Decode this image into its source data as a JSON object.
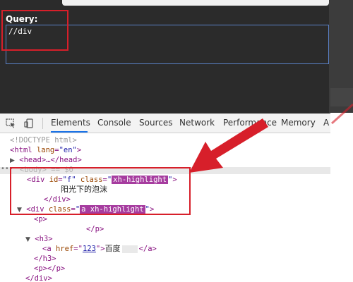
{
  "query_panel": {
    "label": "Query:",
    "value": "//div"
  },
  "toolbar": {
    "icons": [
      "inspect-element-icon",
      "device-toolbar-icon"
    ],
    "tabs": [
      {
        "label": "Elements",
        "active": true
      },
      {
        "label": "Console",
        "active": false
      },
      {
        "label": "Sources",
        "active": false
      },
      {
        "label": "Network",
        "active": false
      },
      {
        "label": "Performance",
        "active": false
      },
      {
        "label": "Memory",
        "active": false
      },
      {
        "label": "A",
        "active": false
      }
    ]
  },
  "tree": {
    "doctype": "<!DOCTYPE html>",
    "html_open": {
      "tag": "<html",
      "attr": "lang",
      "val": "\"en\"",
      "close": ">"
    },
    "head": {
      "open": "<head>",
      "ellipsis": "…",
      "close": "</head>"
    },
    "body_line": "<body> == $0",
    "div1": {
      "open": "<div",
      "id_attr": "id",
      "id_val": "\"f\"",
      "class_attr": "class",
      "class_quote_open": "\"",
      "class_highlight": "xh-highlight",
      "class_quote_close": "\"",
      "close": ">"
    },
    "div1_text": "阳光下的泡沫",
    "div1_end": "</div>",
    "div2": {
      "open": "<div",
      "class_attr": "class",
      "class_highlight": "a xh-highlight",
      "close": ">"
    },
    "p1_open": "<p>",
    "p1_close": "</p>",
    "h3_open": "<h3>",
    "a": {
      "open": "<a",
      "attr": "href",
      "val": "123",
      "text": "百度",
      "close": "</a>"
    },
    "h3_close": "</h3>",
    "p2": "<p></p>",
    "div2_end": "</div>"
  },
  "colors": {
    "highlight_box": "#d71f2a",
    "xpath_highlight": "#a63c9f",
    "panel_bg": "#2b2b2b",
    "active_tab": "#1a73e8"
  }
}
